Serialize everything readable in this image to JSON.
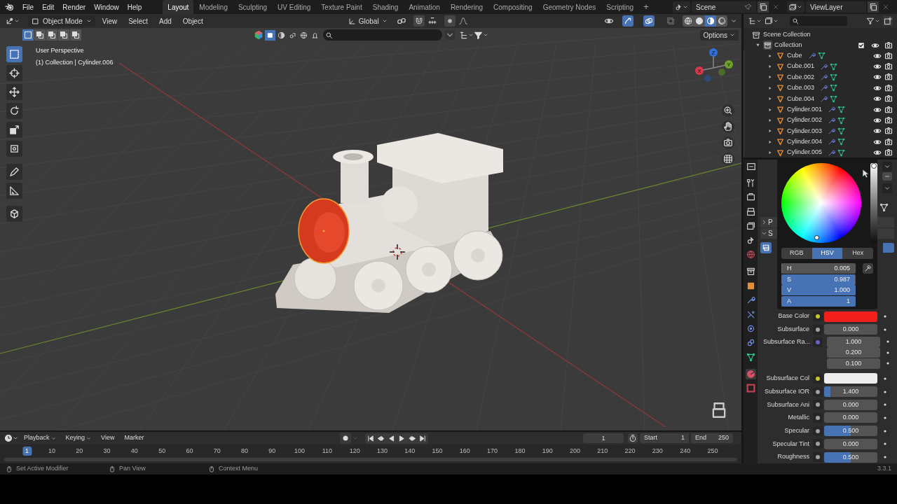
{
  "top_bar": {
    "menus": [
      "File",
      "Edit",
      "Render",
      "Window",
      "Help"
    ],
    "workspaces": [
      {
        "label": "Layout",
        "selected": true
      },
      {
        "label": "Modeling",
        "selected": false
      },
      {
        "label": "Sculpting",
        "selected": false
      },
      {
        "label": "UV Editing",
        "selected": false
      },
      {
        "label": "Texture Paint",
        "selected": false
      },
      {
        "label": "Shading",
        "selected": false
      },
      {
        "label": "Animation",
        "selected": false
      },
      {
        "label": "Rendering",
        "selected": false
      },
      {
        "label": "Compositing",
        "selected": false
      },
      {
        "label": "Geometry Nodes",
        "selected": false
      },
      {
        "label": "Scripting",
        "selected": false
      }
    ],
    "add_workspace": "+",
    "scene": "Scene",
    "view_layer": "ViewLayer"
  },
  "viewport": {
    "mode": "Object Mode",
    "menus": [
      "View",
      "Select",
      "Add",
      "Object"
    ],
    "orientation": "Global",
    "options": "Options",
    "overlay_title": "User Perspective",
    "overlay_info": "(1) Collection | Cylinder.006",
    "tools": [
      {
        "kind": "select",
        "selected": true
      },
      {
        "kind": "cursor",
        "selected": false
      },
      {
        "kind": "move",
        "selected": false
      },
      {
        "kind": "rotate",
        "selected": false
      },
      {
        "kind": "scale",
        "selected": false
      },
      {
        "kind": "transform",
        "selected": false
      },
      {
        "kind": "annotate",
        "selected": false
      },
      {
        "kind": "measure",
        "selected": false
      },
      {
        "kind": "add-cube",
        "selected": false
      }
    ],
    "gizmo_axes": [
      {
        "label": "Z",
        "color": "#2f6fd8"
      },
      {
        "label": "Y",
        "color": "#6ea22a"
      },
      {
        "label": "X",
        "color": "#d8384a"
      }
    ]
  },
  "outliner": {
    "label": "Scene Collection",
    "children": [
      {
        "label": "Collection",
        "expanded": true,
        "checked": true,
        "children": [
          {
            "label": "Cube",
            "expanded": false
          },
          {
            "label": "Cube.001",
            "expanded": false
          },
          {
            "label": "Cube.002",
            "expanded": false
          },
          {
            "label": "Cube.003",
            "expanded": false
          },
          {
            "label": "Cube.004",
            "expanded": false
          },
          {
            "label": "Cylinder.001",
            "expanded": false
          },
          {
            "label": "Cylinder.002",
            "expanded": false
          },
          {
            "label": "Cylinder.003",
            "expanded": false
          },
          {
            "label": "Cylinder.004",
            "expanded": false
          },
          {
            "label": "Cylinder.005",
            "expanded": false
          }
        ]
      }
    ]
  },
  "properties": {
    "panel_fragments": [
      {
        "label": "P",
        "expanded": false
      },
      {
        "label": "S",
        "expanded": true
      }
    ],
    "color_picker": {
      "value_slider": {
        "level": 1
      },
      "modes": [
        {
          "label": "RGB",
          "selected": false
        },
        {
          "label": "HSV",
          "selected": true
        },
        {
          "label": "Hex",
          "selected": false
        }
      ],
      "fields": [
        {
          "label": "H",
          "value": "0.005",
          "level": 0.005
        },
        {
          "label": "S",
          "value": "0.987",
          "level": 0.987
        },
        {
          "label": "V",
          "value": "1.000",
          "level": 1
        },
        {
          "label": "A",
          "value": "1",
          "level": 1
        }
      ]
    },
    "inputs": [
      {
        "kind": "color",
        "label": "Base Color",
        "color": "#c7c729",
        "swatch": {
          "color": "#f2201c"
        }
      },
      {
        "kind": "number",
        "label": "Subsurface",
        "color": "#a1a1a1",
        "value": "0.000"
      },
      {
        "kind": "vector",
        "label": "Subsurface Ra...",
        "color": "#6363c7",
        "values": [
          "1.000",
          "0.200",
          "0.100"
        ]
      },
      {
        "kind": "color",
        "label": "Subsurface Col",
        "color": "#c7c729",
        "swatch": {
          "color": "#ededed"
        }
      },
      {
        "kind": "number",
        "label": "Subsurface IOR",
        "color": "#a1a1a1",
        "value": "1.400",
        "level": 0.12
      },
      {
        "kind": "number",
        "label": "Subsurface Ani",
        "color": "#a1a1a1",
        "value": "0.000"
      },
      {
        "kind": "number",
        "label": "Metallic",
        "color": "#a1a1a1",
        "value": "0.000"
      },
      {
        "kind": "number",
        "label": "Specular",
        "color": "#a1a1a1",
        "value": "0.500",
        "level": 0.5
      },
      {
        "kind": "number",
        "label": "Specular Tint",
        "color": "#a1a1a1",
        "value": "0.000"
      },
      {
        "kind": "number",
        "label": "Roughness",
        "color": "#a1a1a1",
        "value": "0.500",
        "level": 0.5
      }
    ]
  },
  "timeline": {
    "menus": [
      "Playback",
      "Keying",
      "View",
      "Marker"
    ],
    "current_frame": "1",
    "start_label": "Start",
    "start": "1",
    "end_label": "End",
    "end": "250",
    "ruler": [
      {
        "label": "1",
        "selected": true
      },
      {
        "label": "10",
        "selected": false
      },
      {
        "label": "20",
        "selected": false
      },
      {
        "label": "30",
        "selected": false
      },
      {
        "label": "40",
        "selected": false
      },
      {
        "label": "50",
        "selected": false
      },
      {
        "label": "60",
        "selected": false
      },
      {
        "label": "70",
        "selected": false
      },
      {
        "label": "80",
        "selected": false
      },
      {
        "label": "90",
        "selected": false
      },
      {
        "label": "100",
        "selected": false
      },
      {
        "label": "110",
        "selected": false
      },
      {
        "label": "120",
        "selected": false
      },
      {
        "label": "130",
        "selected": false
      },
      {
        "label": "140",
        "selected": false
      },
      {
        "label": "150",
        "selected": false
      },
      {
        "label": "160",
        "selected": false
      },
      {
        "label": "170",
        "selected": false
      },
      {
        "label": "180",
        "selected": false
      },
      {
        "label": "190",
        "selected": false
      },
      {
        "label": "200",
        "selected": false
      },
      {
        "label": "210",
        "selected": false
      },
      {
        "label": "220",
        "selected": false
      },
      {
        "label": "230",
        "selected": false
      },
      {
        "label": "240",
        "selected": false
      },
      {
        "label": "250",
        "selected": false
      }
    ]
  },
  "status_bar": {
    "hints": [
      "Set Active Modifier",
      "Pan View",
      "Context Menu"
    ],
    "version": "3.3.1"
  }
}
